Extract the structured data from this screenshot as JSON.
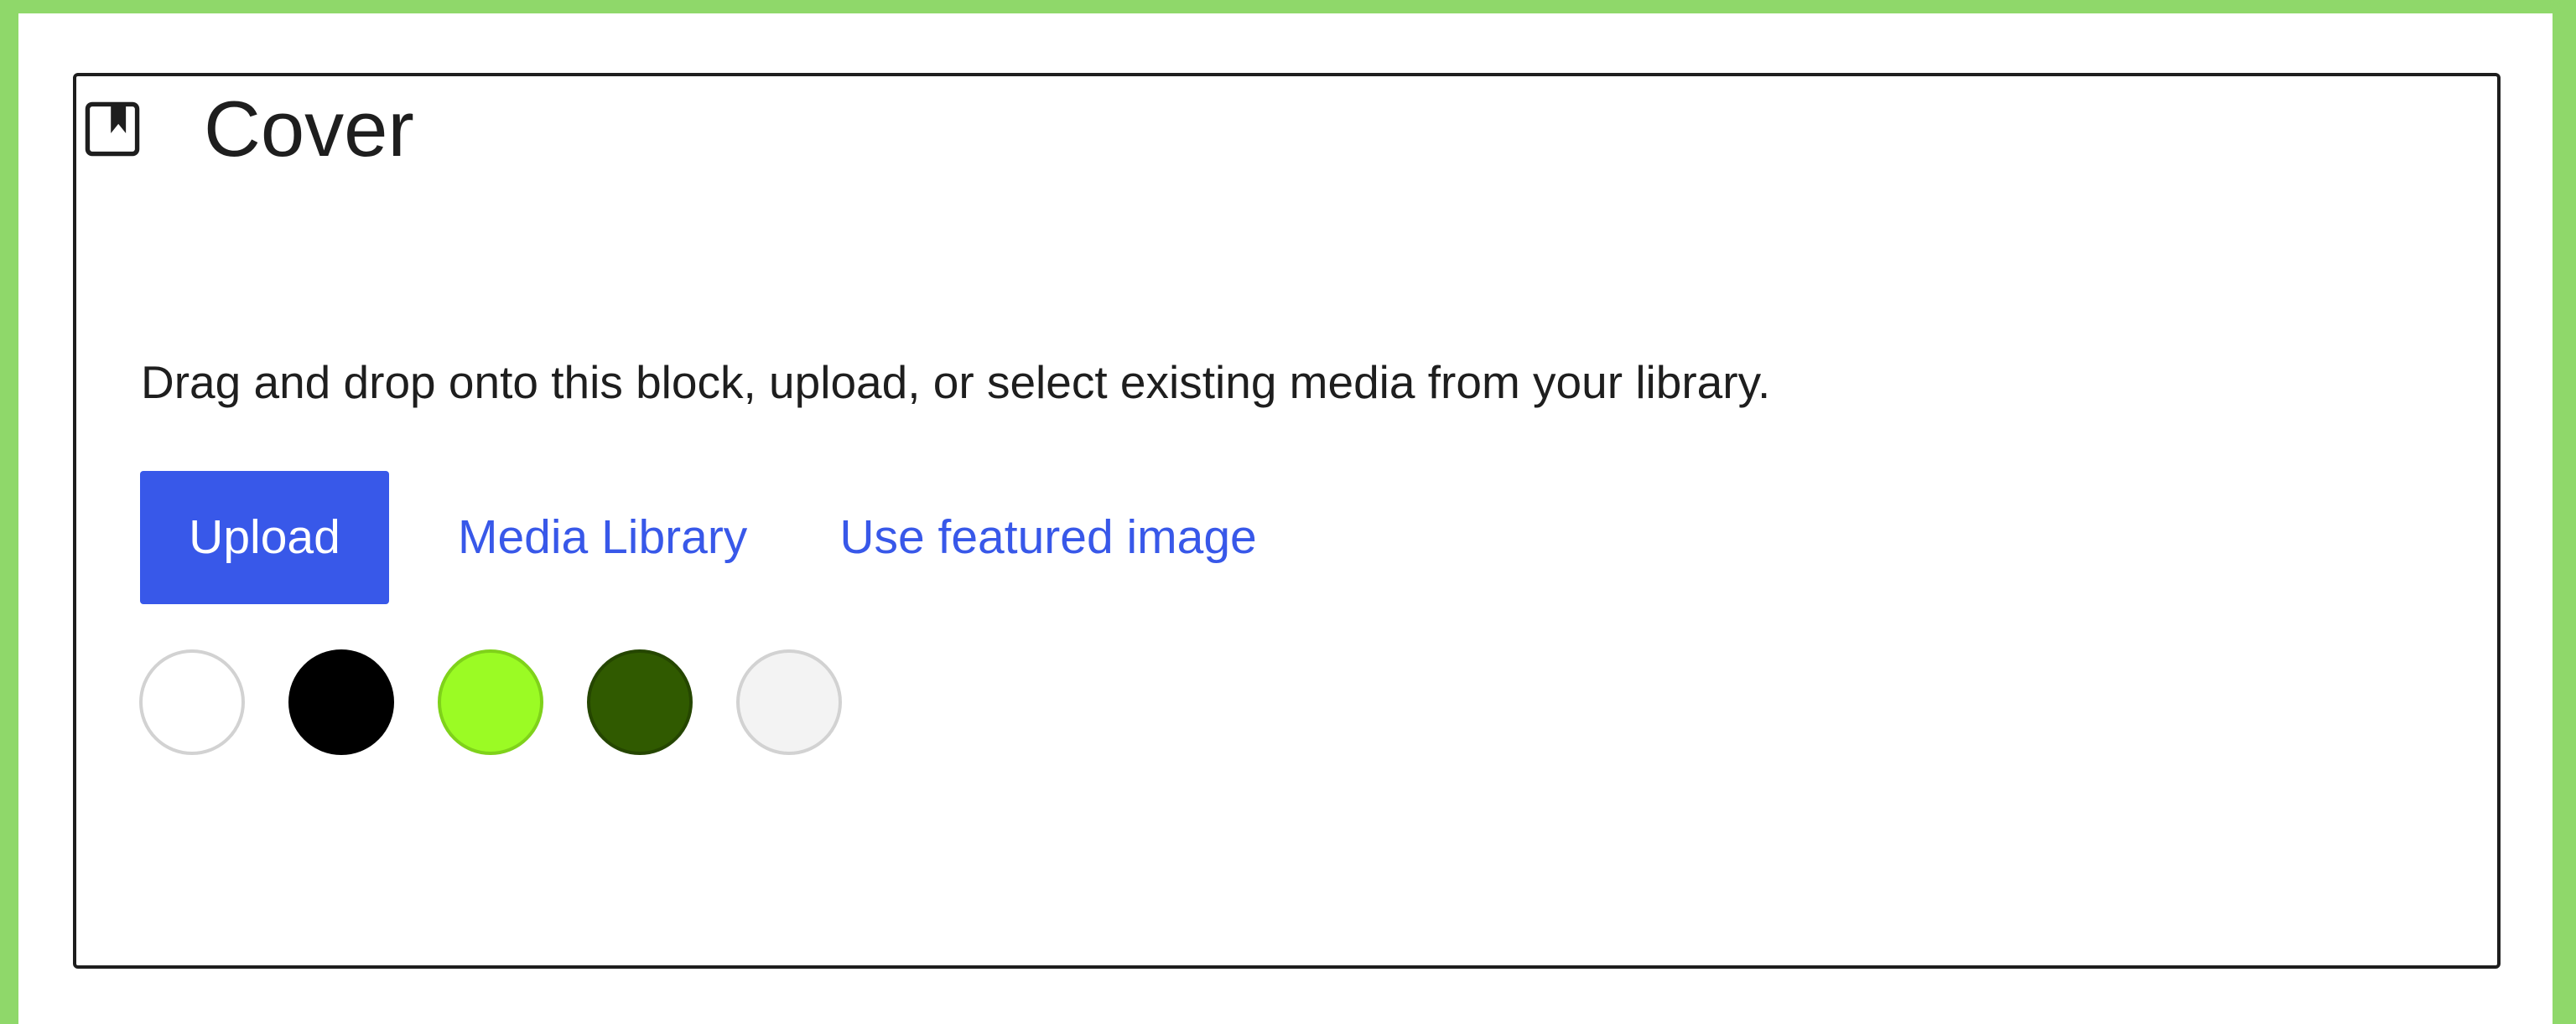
{
  "cover_block": {
    "title": "Cover",
    "icon": "cover-block-icon",
    "instructions": "Drag and drop onto this block, upload, or select existing media from your library.",
    "buttons": {
      "upload": "Upload",
      "media_library": "Media Library",
      "use_featured_image": "Use featured image"
    },
    "color_swatches": [
      {
        "name": "white",
        "color": "#ffffff",
        "border": "#d2d2d2"
      },
      {
        "name": "black",
        "color": "#000000",
        "border": "#000000"
      },
      {
        "name": "lime-green",
        "color": "#9bfb24",
        "border": "#7fd21a"
      },
      {
        "name": "dark-green",
        "color": "#305a00",
        "border": "#254600"
      },
      {
        "name": "light-gray",
        "color": "#f3f3f3",
        "border": "#d2d2d2"
      }
    ]
  },
  "colors": {
    "accent": "#3858e9",
    "frame": "#8fd86a",
    "text": "#1e1e1e"
  }
}
